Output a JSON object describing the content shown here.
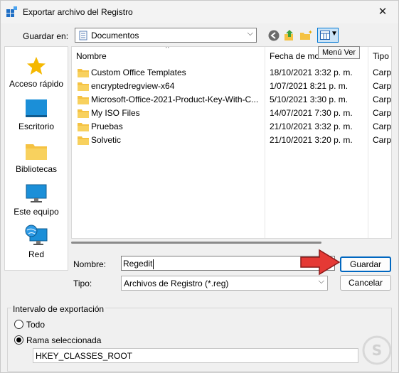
{
  "window": {
    "title": "Exportar archivo del Registro"
  },
  "save_in": {
    "label": "Guardar en:",
    "value": "Documentos"
  },
  "toolbar": {
    "tooltip": "Menú Ver"
  },
  "places": [
    "Acceso rápido",
    "Escritorio",
    "Bibliotecas",
    "Este equipo",
    "Red"
  ],
  "list": {
    "columns": [
      "Nombre",
      "Fecha de mo",
      "Tipo"
    ],
    "rows": [
      {
        "name": "Custom Office Templates",
        "date": "18/10/2021 3:32 p. m.",
        "type": "Carpe"
      },
      {
        "name": "encryptedregview-x64",
        "date": "1/07/2021 8:21 p. m.",
        "type": "Carpe"
      },
      {
        "name": "Microsoft-Office-2021-Product-Key-With-C...",
        "date": "5/10/2021 3:30 p. m.",
        "type": "Carpe"
      },
      {
        "name": "My ISO Files",
        "date": "14/07/2021 7:30 p. m.",
        "type": "Carpe"
      },
      {
        "name": "Pruebas",
        "date": "21/10/2021 3:32 p. m.",
        "type": "Carpe"
      },
      {
        "name": "Solvetic",
        "date": "21/10/2021 3:20 p. m.",
        "type": "Carpe"
      }
    ]
  },
  "filename": {
    "label": "Nombre:",
    "value": "Regedit"
  },
  "filetype": {
    "label": "Tipo:",
    "value": "Archivos de Registro (*.reg)"
  },
  "buttons": {
    "save": "Guardar",
    "cancel": "Cancelar"
  },
  "export_range": {
    "title": "Intervalo de exportación",
    "all": "Todo",
    "selected": "Rama seleccionada",
    "branch": "HKEY_CLASSES_ROOT"
  },
  "colors": {
    "accent": "#0067c0",
    "folder": "#f5c242",
    "arrow": "#e53935"
  }
}
